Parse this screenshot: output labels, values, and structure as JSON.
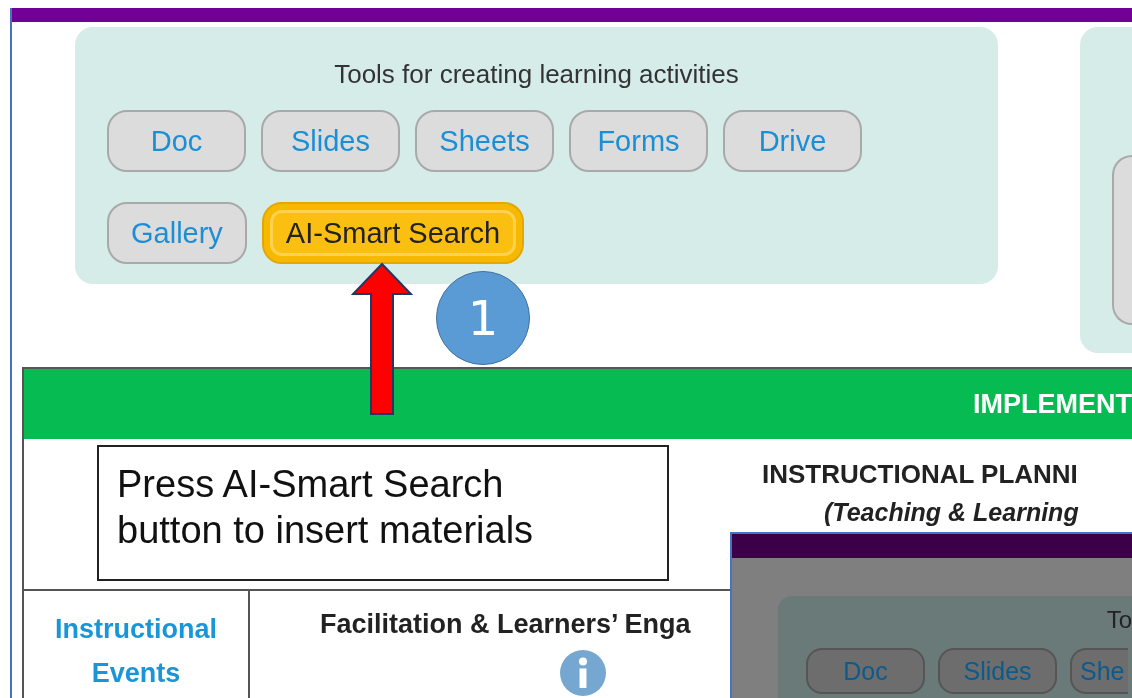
{
  "tools_card": {
    "title": "Tools for creating learning activities",
    "buttons": [
      {
        "label": "Doc",
        "highlighted": false
      },
      {
        "label": "Slides",
        "highlighted": false
      },
      {
        "label": "Sheets",
        "highlighted": false
      },
      {
        "label": "Forms",
        "highlighted": false
      },
      {
        "label": "Drive",
        "highlighted": false
      },
      {
        "label": "Gallery",
        "highlighted": false
      },
      {
        "label": "AI-Smart Search",
        "highlighted": true
      }
    ]
  },
  "banner": {
    "title": "IMPLEMENT"
  },
  "section": {
    "title": "INSTRUCTIONAL PLANNI",
    "subtitle": "(Teaching & Learning"
  },
  "table": {
    "columns": [
      "Instructional Events",
      "Facilitation & Learners’ Enga"
    ]
  },
  "callout": {
    "text": "Press AI-Smart Search button to insert materials",
    "step": "1"
  },
  "inset": {
    "card_title": "To",
    "buttons": [
      {
        "label": "Doc",
        "highlighted": false
      },
      {
        "label": "Slides",
        "highlighted": false
      },
      {
        "label": "She",
        "highlighted": false
      }
    ]
  }
}
